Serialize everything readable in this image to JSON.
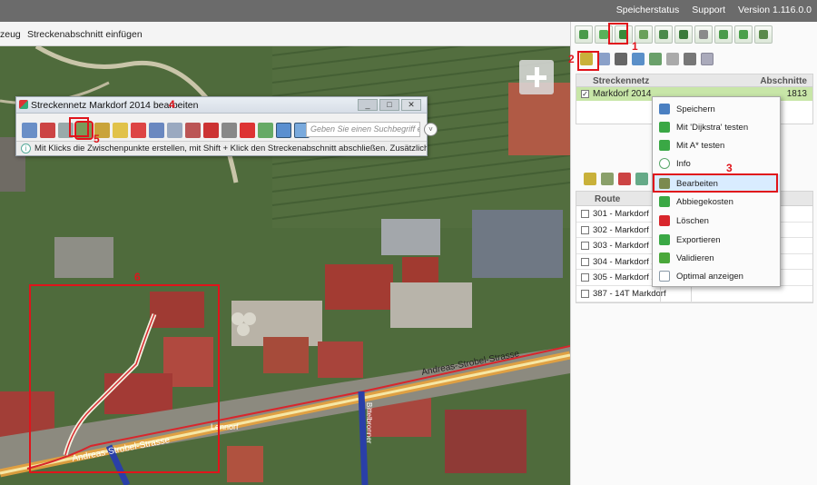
{
  "topbar": {
    "links": [
      "Speicherstatus",
      "Support",
      "Version 1.116.0.0"
    ]
  },
  "toolbar": {
    "item1": "zeug",
    "item2": "Streckenabschnitt einfügen"
  },
  "map": {
    "street_labels": [
      "Andreas-Strobel-Strasse",
      "Andreas-Strobel-Strasse",
      "Lennorf",
      "Bittelbronner"
    ]
  },
  "float_window": {
    "title": "Streckennetz Markdorf 2014 bearbeiten",
    "search_placeholder": "Geben Sie einen Suchbegriff e",
    "search_button": "˅",
    "status_text": "Mit Klicks die Zwischenpunkte erstellen, mit Shift + Klick den Streckenabschnitt abschließen. Zusätzlich Strg für c",
    "win_buttons": [
      "_",
      "□",
      "✕"
    ]
  },
  "panel": {
    "network_grid": {
      "headers": [
        "Streckennetz",
        "Abschnitte"
      ],
      "rows": [
        {
          "name": "Markdorf 2014",
          "count": "1813",
          "checked": "✓"
        }
      ]
    },
    "route_grid": {
      "headers": [
        "Route"
      ],
      "rows": [
        "301 - Markdorf 1",
        "302 - Markdorf 1",
        "303 - Markdorf 1",
        "304 - Markdorf 2",
        "305 - Markdorf 2",
        "387 - 14T Markdorf"
      ]
    }
  },
  "context_menu": {
    "items": [
      {
        "label": "Speichern",
        "icon": "save-icon",
        "color": "#4a7fc1"
      },
      {
        "label": "Mit 'Dijkstra' testen",
        "icon": "dijkstra-icon",
        "color": "#3aa845"
      },
      {
        "label": "Mit A* testen",
        "icon": "astar-icon",
        "color": "#3aa845"
      },
      {
        "label": "Info",
        "icon": "info-icon",
        "color": "#5aa86a"
      },
      {
        "label": "Bearbeiten",
        "icon": "edit-icon",
        "color": "#7b8a4f"
      },
      {
        "label": "Abbiegekosten",
        "icon": "turn-cost-icon",
        "color": "#3aa845"
      },
      {
        "label": "Löschen",
        "icon": "delete-icon",
        "color": "#d8262c"
      },
      {
        "label": "Exportieren",
        "icon": "export-icon",
        "color": "#3aa845"
      },
      {
        "label": "Validieren",
        "icon": "validate-icon",
        "color": "#4aa83a"
      },
      {
        "label": "Optimal anzeigen",
        "icon": "fit-view-icon",
        "color": "#8a9aa8"
      }
    ]
  },
  "annotations": [
    "1",
    "2",
    "3",
    "4",
    "5",
    "6"
  ],
  "colors": {
    "annotation_red": "#e0141b",
    "selection_green": "#c8e6a8",
    "topbar_gray": "#6b6b6b"
  }
}
